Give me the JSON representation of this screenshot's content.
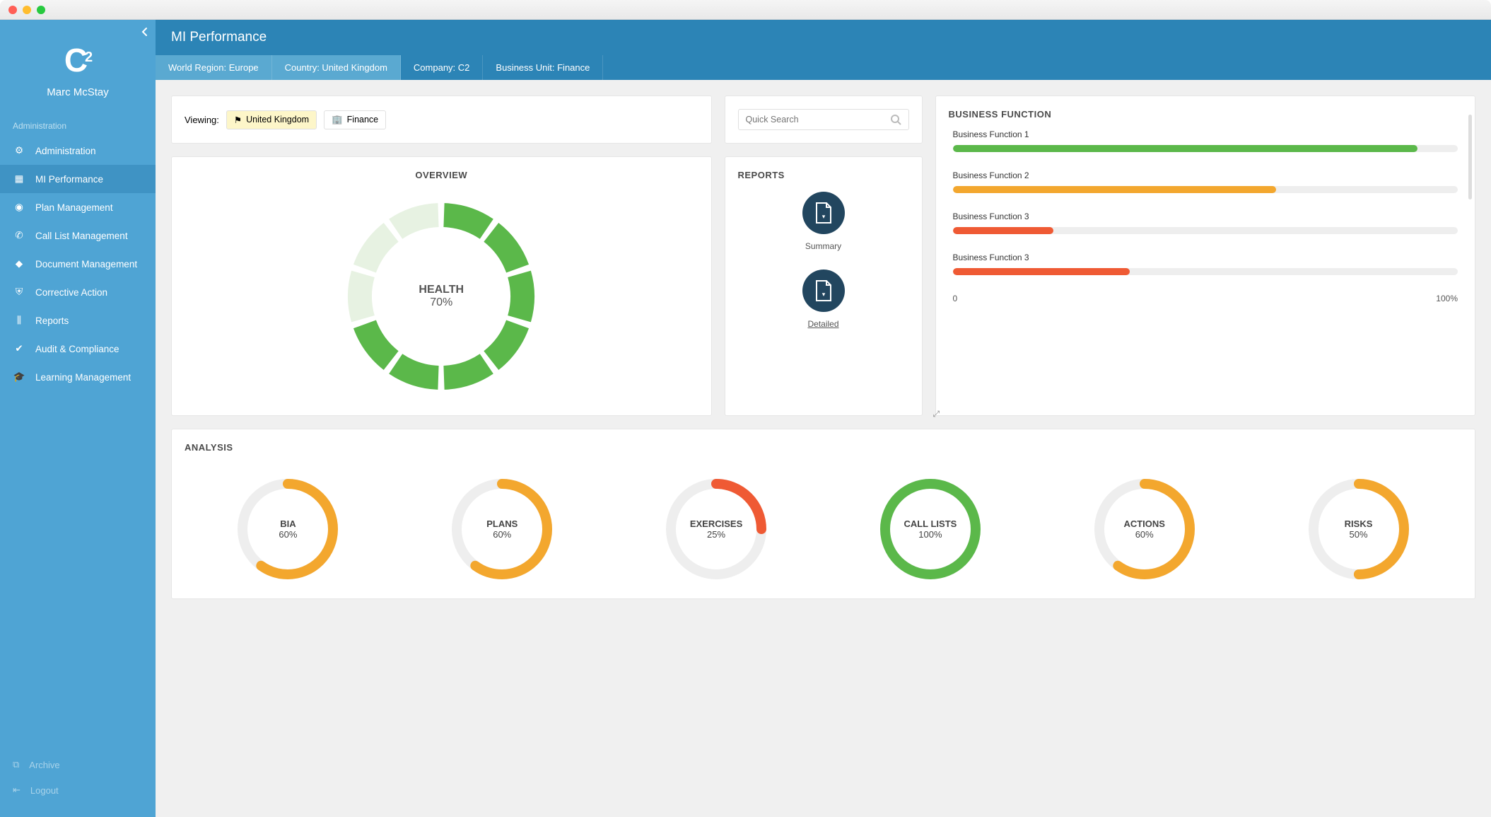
{
  "user": {
    "name": "Marc McStay"
  },
  "page_title": "MI Performance",
  "sidebar": {
    "section_label": "Administration",
    "items": [
      {
        "label": "Administration"
      },
      {
        "label": "MI Performance"
      },
      {
        "label": "Plan Management"
      },
      {
        "label": "Call List Management"
      },
      {
        "label": "Document Management"
      },
      {
        "label": "Corrective Action"
      },
      {
        "label": "Reports"
      },
      {
        "label": "Audit & Compliance"
      },
      {
        "label": "Learning Management"
      }
    ],
    "footer": [
      {
        "label": "Archive"
      },
      {
        "label": "Logout"
      }
    ]
  },
  "breadcrumbs": [
    {
      "label": "World Region: Europe"
    },
    {
      "label": "Country: United Kingdom"
    },
    {
      "label": "Company: C2"
    },
    {
      "label": "Business Unit: Finance"
    }
  ],
  "viewing": {
    "label": "Viewing:",
    "country": "United Kingdom",
    "unit": "Finance"
  },
  "search": {
    "placeholder": "Quick Search"
  },
  "overview": {
    "title": "OVERVIEW",
    "label": "HEALTH",
    "percent_text": "70%"
  },
  "reports": {
    "title": "REPORTS",
    "summary": "Summary",
    "detailed": "Detailed"
  },
  "bizfn": {
    "title": "BUSINESS FUNCTION",
    "rows": [
      {
        "name": "Business Function 1",
        "pct": 92,
        "color": "#5bb84a"
      },
      {
        "name": "Business Function 2",
        "pct": 64,
        "color": "#f3a72e"
      },
      {
        "name": "Business Function 3",
        "pct": 20,
        "color": "#ef5a34"
      },
      {
        "name": "Business Function 3",
        "pct": 35,
        "color": "#ef5a34"
      }
    ],
    "scale_min": "0",
    "scale_max": "100%"
  },
  "analysis": {
    "title": "ANALYSIS",
    "items": [
      {
        "label": "BIA",
        "pct": 60,
        "pct_text": "60%",
        "color": "#f3a72e"
      },
      {
        "label": "PLANS",
        "pct": 60,
        "pct_text": "60%",
        "color": "#f3a72e"
      },
      {
        "label": "EXERCISES",
        "pct": 25,
        "pct_text": "25%",
        "color": "#ef5a34"
      },
      {
        "label": "CALL LISTS",
        "pct": 100,
        "pct_text": "100%",
        "color": "#5bb84a"
      },
      {
        "label": "ACTIONS",
        "pct": 60,
        "pct_text": "60%",
        "color": "#f3a72e"
      },
      {
        "label": "RISKS",
        "pct": 50,
        "pct_text": "50%",
        "color": "#f3a72e"
      }
    ]
  },
  "chart_data": {
    "health_donut": {
      "type": "pie",
      "title": "HEALTH",
      "value": 70,
      "max": 100,
      "segments": 10,
      "filled_color": "#5bb84a",
      "empty_color": "#e7f2e2"
    },
    "business_function_bars": {
      "type": "bar",
      "title": "BUSINESS FUNCTION",
      "xlim": [
        0,
        100
      ],
      "categories": [
        "Business Function 1",
        "Business Function 2",
        "Business Function 3",
        "Business Function 3"
      ],
      "values": [
        92,
        64,
        20,
        35
      ],
      "colors": [
        "#5bb84a",
        "#f3a72e",
        "#ef5a34",
        "#ef5a34"
      ]
    },
    "analysis_rings": [
      {
        "type": "pie",
        "label": "BIA",
        "value": 60,
        "max": 100,
        "color": "#f3a72e"
      },
      {
        "type": "pie",
        "label": "PLANS",
        "value": 60,
        "max": 100,
        "color": "#f3a72e"
      },
      {
        "type": "pie",
        "label": "EXERCISES",
        "value": 25,
        "max": 100,
        "color": "#ef5a34"
      },
      {
        "type": "pie",
        "label": "CALL LISTS",
        "value": 100,
        "max": 100,
        "color": "#5bb84a"
      },
      {
        "type": "pie",
        "label": "ACTIONS",
        "value": 60,
        "max": 100,
        "color": "#f3a72e"
      },
      {
        "type": "pie",
        "label": "RISKS",
        "value": 50,
        "max": 100,
        "color": "#f3a72e"
      }
    ]
  }
}
